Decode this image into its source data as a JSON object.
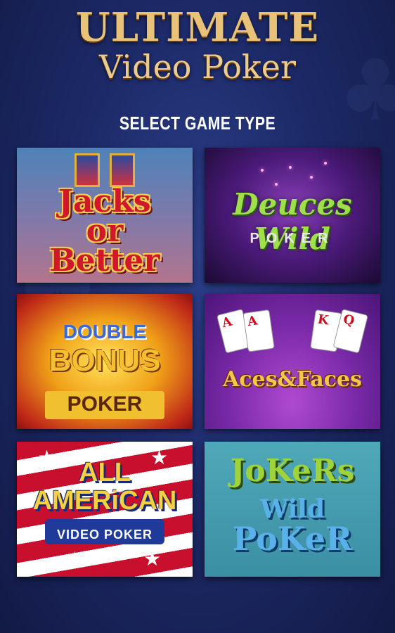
{
  "header": {
    "title": "ULTIMATE",
    "subtitle": "Video Poker",
    "select_label": "SELECT GAME TYPE"
  },
  "games": [
    {
      "id": "jacks_or_better",
      "line1": "Jacks",
      "line2": "or",
      "line3": "Better"
    },
    {
      "id": "deuces_wild",
      "line1": "Deuces Wild",
      "line2": "POKER"
    },
    {
      "id": "double_bonus",
      "line1": "DOUBLE",
      "line2": "BONUS",
      "line3": "POKER"
    },
    {
      "id": "aces_faces",
      "line1": "Aces&Faces"
    },
    {
      "id": "all_american",
      "line1": "ALL",
      "line2": "AMERiCAN",
      "line3": "VIDEO POKER"
    },
    {
      "id": "jokers_wild",
      "line1": "JoKeRs",
      "line2": "Wild",
      "line3": "PoKeR"
    }
  ],
  "colors": {
    "background": "#1d2a68",
    "title_gold": "#e9c27a"
  }
}
